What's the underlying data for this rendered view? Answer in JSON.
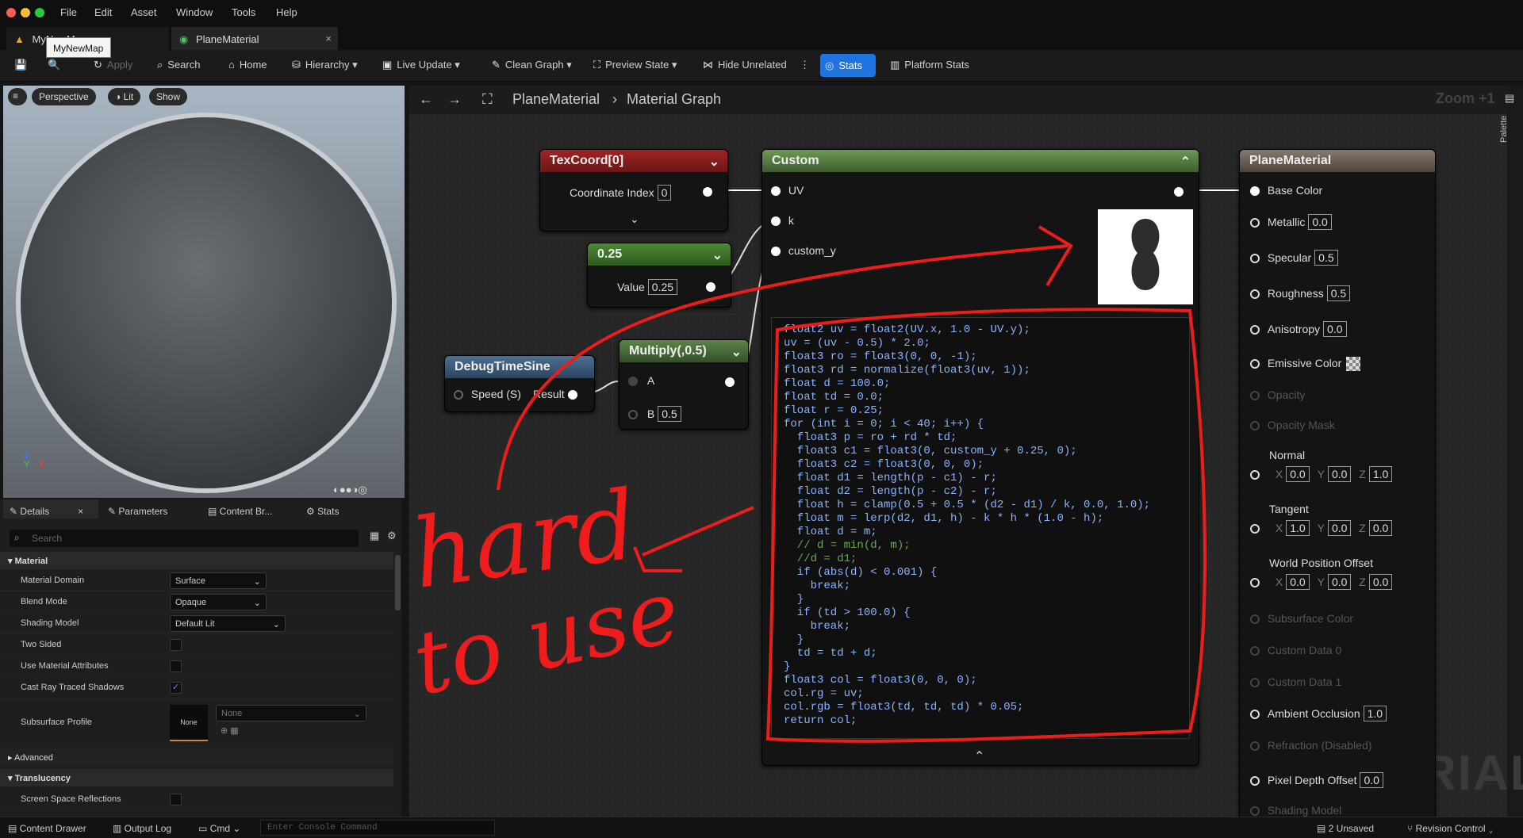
{
  "menu": [
    "File",
    "Edit",
    "Asset",
    "Window",
    "Tools",
    "Help"
  ],
  "tabs": [
    {
      "label": "MyNewMap"
    },
    {
      "label": "PlaneMaterial"
    }
  ],
  "tooltip": "MyNewMap",
  "toolbar": {
    "apply": "Apply",
    "search": "Search",
    "home": "Home",
    "hierarchy": "Hierarchy",
    "live_update": "Live Update",
    "clean_graph": "Clean Graph",
    "preview_state": "Preview State",
    "hide_unrelated": "Hide Unrelated",
    "stats": "Stats",
    "platform_stats": "Platform Stats"
  },
  "viewport": {
    "perspective": "Perspective",
    "lit": "Lit",
    "show": "Show",
    "axis_z": "Z",
    "axis_x": "X",
    "axis_y": "Y"
  },
  "details": {
    "tabs": [
      "Details",
      "Parameters",
      "Content Br...",
      "Stats"
    ],
    "search_placeholder": "Search",
    "sections": {
      "material": "Material",
      "advanced": "Advanced",
      "translucency": "Translucency"
    },
    "rows": [
      {
        "label": "Material Domain",
        "value": "Surface"
      },
      {
        "label": "Blend Mode",
        "value": "Opaque"
      },
      {
        "label": "Shading Model",
        "value": "Default Lit"
      },
      {
        "label": "Two Sided",
        "value": ""
      },
      {
        "label": "Use Material Attributes",
        "value": ""
      },
      {
        "label": "Cast Ray Traced Shadows",
        "value": "✓"
      },
      {
        "label": "Subsurface Profile",
        "value": "None"
      }
    ],
    "subsurface_thumb": "None",
    "ssr": "Screen Space Reflections"
  },
  "graph": {
    "crumb_material": "PlaneMaterial",
    "crumb_graph": "Material Graph",
    "zoom": "Zoom +1",
    "palette": "Palette",
    "watermark": "MATERIAL"
  },
  "nodes": {
    "texcoord": {
      "title": "TexCoord[0]",
      "label": "Coordinate Index",
      "value": "0"
    },
    "const": {
      "title": "0.25",
      "label": "Value",
      "value": "0.25"
    },
    "debug": {
      "title": "DebugTimeSine",
      "speed": "Speed (S)",
      "result": "Result"
    },
    "multiply": {
      "title": "Multiply(,0.5)",
      "a": "A",
      "b": "B",
      "b_value": "0.5"
    },
    "custom": {
      "title": "Custom",
      "inputs": [
        "UV",
        "k",
        "custom_y"
      ]
    },
    "material": {
      "title": "PlaneMaterial",
      "pins": [
        {
          "label": "Base Color",
          "value": ""
        },
        {
          "label": "Metallic",
          "value": "0.0"
        },
        {
          "label": "Specular",
          "value": "0.5"
        },
        {
          "label": "Roughness",
          "value": "0.5"
        },
        {
          "label": "Anisotropy",
          "value": "0.0"
        },
        {
          "label": "Emissive Color",
          "value": ""
        }
      ],
      "disabled": [
        "Opacity",
        "Opacity Mask",
        "Subsurface Color",
        "Custom Data 0",
        "Custom Data 1",
        "Refraction (Disabled)",
        "Shading Model"
      ],
      "normal": {
        "label": "Normal",
        "x": "0.0",
        "y": "0.0",
        "z": "1.0"
      },
      "tangent": {
        "label": "Tangent",
        "x": "1.0",
        "y": "0.0",
        "z": "0.0"
      },
      "wpo": {
        "label": "World Position Offset",
        "x": "0.0",
        "y": "0.0",
        "z": "0.0"
      },
      "ao": {
        "label": "Ambient Occlusion",
        "value": "1.0"
      },
      "pdo": {
        "label": "Pixel Depth Offset",
        "value": "0.0"
      },
      "axis": {
        "x": "X",
        "y": "Y",
        "z": "Z"
      }
    }
  },
  "code": [
    "float2 uv = float2(UV.x, 1.0 - UV.y);",
    "uv = (uv - 0.5) * 2.0;",
    "float3 ro = float3(0, 0, -1);",
    "float3 rd = normalize(float3(uv, 1));",
    "float d = 100.0;",
    "float td = 0.0;",
    "float r = 0.25;",
    "for (int i = 0; i < 40; i++) {",
    "  float3 p = ro + rd * td;",
    "  float3 c1 = float3(0, custom_y + 0.25, 0);",
    "  float3 c2 = float3(0, 0, 0);",
    "  float d1 = length(p - c1) - r;",
    "  float d2 = length(p - c2) - r;",
    "  float h = clamp(0.5 + 0.5 * (d2 - d1) / k, 0.0, 1.0);",
    "  float m = lerp(d2, d1, h) - k * h * (1.0 - h);",
    "  float d = m;",
    "  // d = min(d, m);",
    "  //d = d1;",
    "  if (abs(d) < 0.001) {",
    "    break;",
    "  }",
    "  if (td > 100.0) {",
    "    break;",
    "  }",
    "  td = td + d;",
    "}",
    "float3 col = float3(0, 0, 0);",
    "col.rg = uv;",
    "col.rgb = float3(td, td, td) * 0.05;",
    "return col;"
  ],
  "annotation": {
    "line1": "hard",
    "line2": "to use",
    "color": "#ee1c1c"
  },
  "status": {
    "content_drawer": "Content Drawer",
    "output_log": "Output Log",
    "cmd": "Cmd",
    "console_placeholder": "Enter Console Command",
    "unsaved": "2 Unsaved",
    "revision": "Revision Control"
  },
  "colors": {
    "accent": "#1f74e0",
    "texcoord_head": "#8a1f1f",
    "const_head": "#3f6b2b",
    "debug_head": "#3c5a78",
    "multiply_head": "#4a6a3a",
    "custom_head": "#5a7a4a",
    "material_head": "#6b6258"
  }
}
